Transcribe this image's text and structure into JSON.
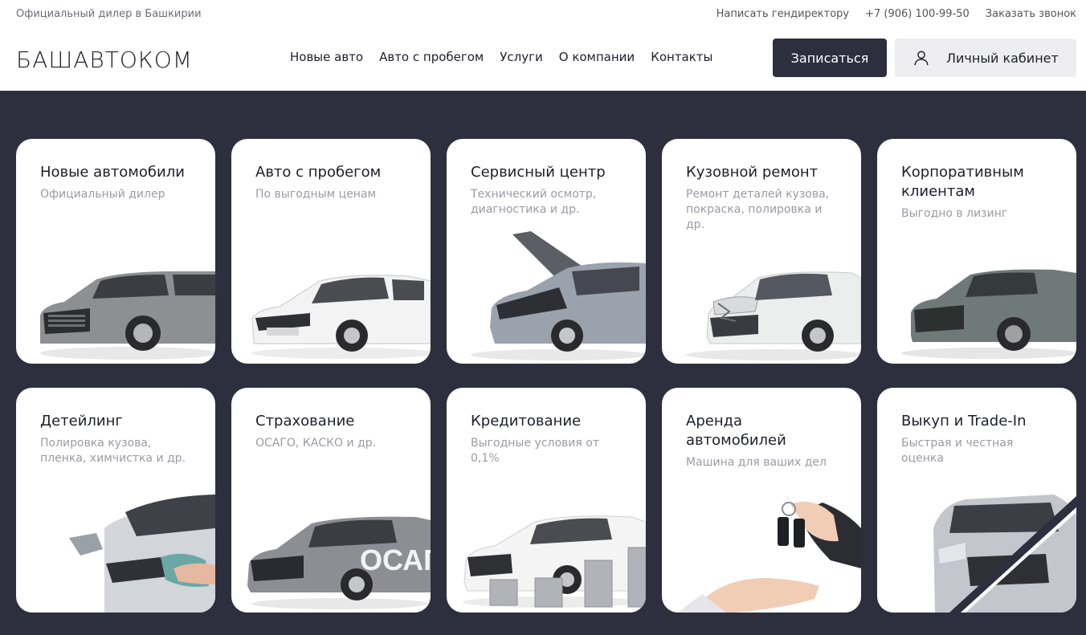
{
  "topbar": {
    "tagline": "Официальный дилер в Башкирии",
    "links": [
      "Написать гендиректору",
      "+7 (906) 100-99-50",
      "Заказать звонок"
    ]
  },
  "logo": "БАШАВТОКОМ",
  "nav": [
    "Новые авто",
    "Авто с пробегом",
    "Услуги",
    "О компании",
    "Контакты"
  ],
  "buttons": {
    "signup": "Записаться",
    "cabinet": "Личный кабинет"
  },
  "cards": [
    {
      "title": "Новые автомобили",
      "subtitle": "Официальный дилер",
      "icon": "grey-suv-image"
    },
    {
      "title": "Авто с пробегом",
      "subtitle": "По выгодным ценам",
      "icon": "white-sedan-image"
    },
    {
      "title": "Сервисный центр",
      "subtitle": "Технический осмотр, диагностика и др.",
      "icon": "car-open-hood-image"
    },
    {
      "title": "Кузовной ремонт",
      "subtitle": "Ремонт деталей кузова, покраска, полировка и др.",
      "icon": "damaged-car-image"
    },
    {
      "title": "Корпоративным клиентам",
      "subtitle": "Выгодно в лизинг",
      "icon": "green-suv-image"
    },
    {
      "title": "Детейлинг",
      "subtitle": "Полировка кузова, пленка, химчистка и др.",
      "icon": "car-polishing-image"
    },
    {
      "title": "Страхование",
      "subtitle": "ОСАГО, КАСКО и др.",
      "icon": "insured-suv-image",
      "overlay_text": "ОСАГ"
    },
    {
      "title": "Кредитование",
      "subtitle": "Выгодные условия от 0,1%",
      "icon": "car-coins-image"
    },
    {
      "title": "Аренда автомобилей",
      "subtitle": "Машина для ваших дел",
      "icon": "car-keys-handover-image"
    },
    {
      "title": "Выкуп и Trade-In",
      "subtitle": "Быстрая и честная оценка",
      "icon": "trade-in-car-image"
    }
  ],
  "colors": {
    "dark": "#2d2f3f",
    "light_button": "#eeeef0",
    "subtitle": "#9a9ba2"
  }
}
